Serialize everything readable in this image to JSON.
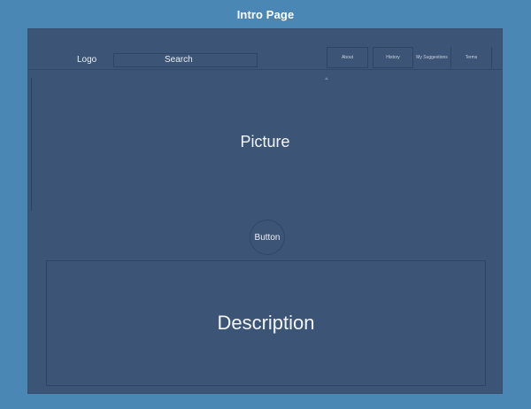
{
  "page": {
    "title": "Intro Page"
  },
  "header": {
    "logo": "Logo",
    "search": "Search",
    "nav": [
      {
        "label": "About"
      },
      {
        "label": "History"
      },
      {
        "label": "My Suggestions"
      },
      {
        "label": "Terms"
      }
    ]
  },
  "main": {
    "picture_label": "Picture",
    "button_label": "Button",
    "description_label": "Description"
  },
  "colors": {
    "background": "#4a87b4",
    "frame": "#3c5576",
    "border": "#2f4564",
    "text": "#f2f5f8"
  }
}
